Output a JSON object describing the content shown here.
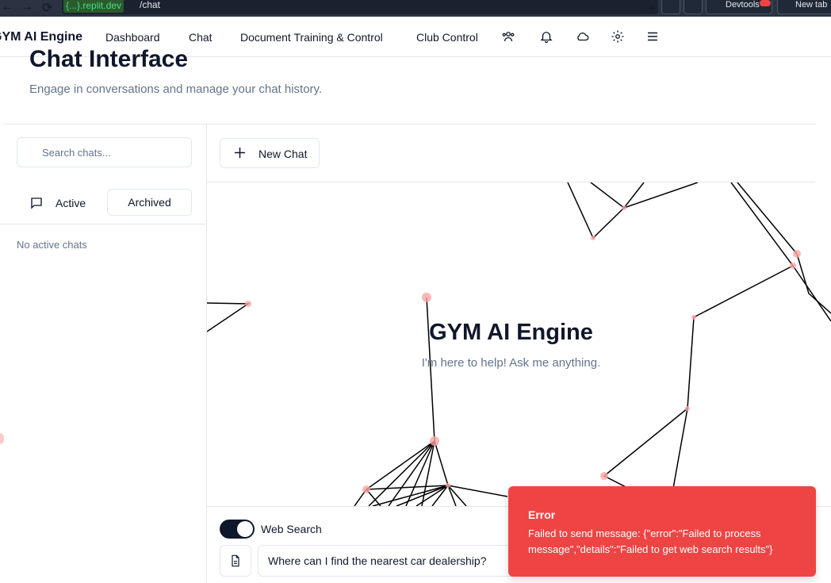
{
  "browser": {
    "back_icon": "arrow-left-icon",
    "forward_icon": "arrow-right-icon",
    "reload_icon": "reload-icon",
    "url_host": "{...}.replit.dev",
    "url_path": "/chat",
    "devtools_label": "Devtools",
    "new_tab_label": "New tab"
  },
  "header": {
    "brand": "GYM AI Engine",
    "nav": [
      "Dashboard",
      "Chat",
      "Document Training & Control",
      "Club Control"
    ],
    "icons": [
      "users-icon",
      "bell-icon",
      "cloud-icon",
      "gear-icon",
      "menu-icon"
    ]
  },
  "page": {
    "title": "Chat Interface",
    "subtitle": "Engage in conversations and manage your chat history."
  },
  "sidebar": {
    "search_placeholder": "Search chats...",
    "tab_active": "Active",
    "tab_archived": "Archived",
    "empty_text": "No active chats"
  },
  "main": {
    "new_chat_label": "New Chat",
    "hero_title": "GYM AI Engine",
    "hero_subtitle": "I'm here to help! Ask me anything.",
    "web_search_label": "Web Search",
    "web_search_on": true,
    "message_value": "Where can I find the nearest car dealership?"
  },
  "toast": {
    "title": "Error",
    "message": "Failed to send message: {\"error\":\"Failed to process message\",\"details\":\"Failed to get web search results\"}"
  },
  "colors": {
    "accent": "#0f172a",
    "error": "#ef4444",
    "muted_text": "#64748b",
    "node_dot": "#fca5a5"
  }
}
